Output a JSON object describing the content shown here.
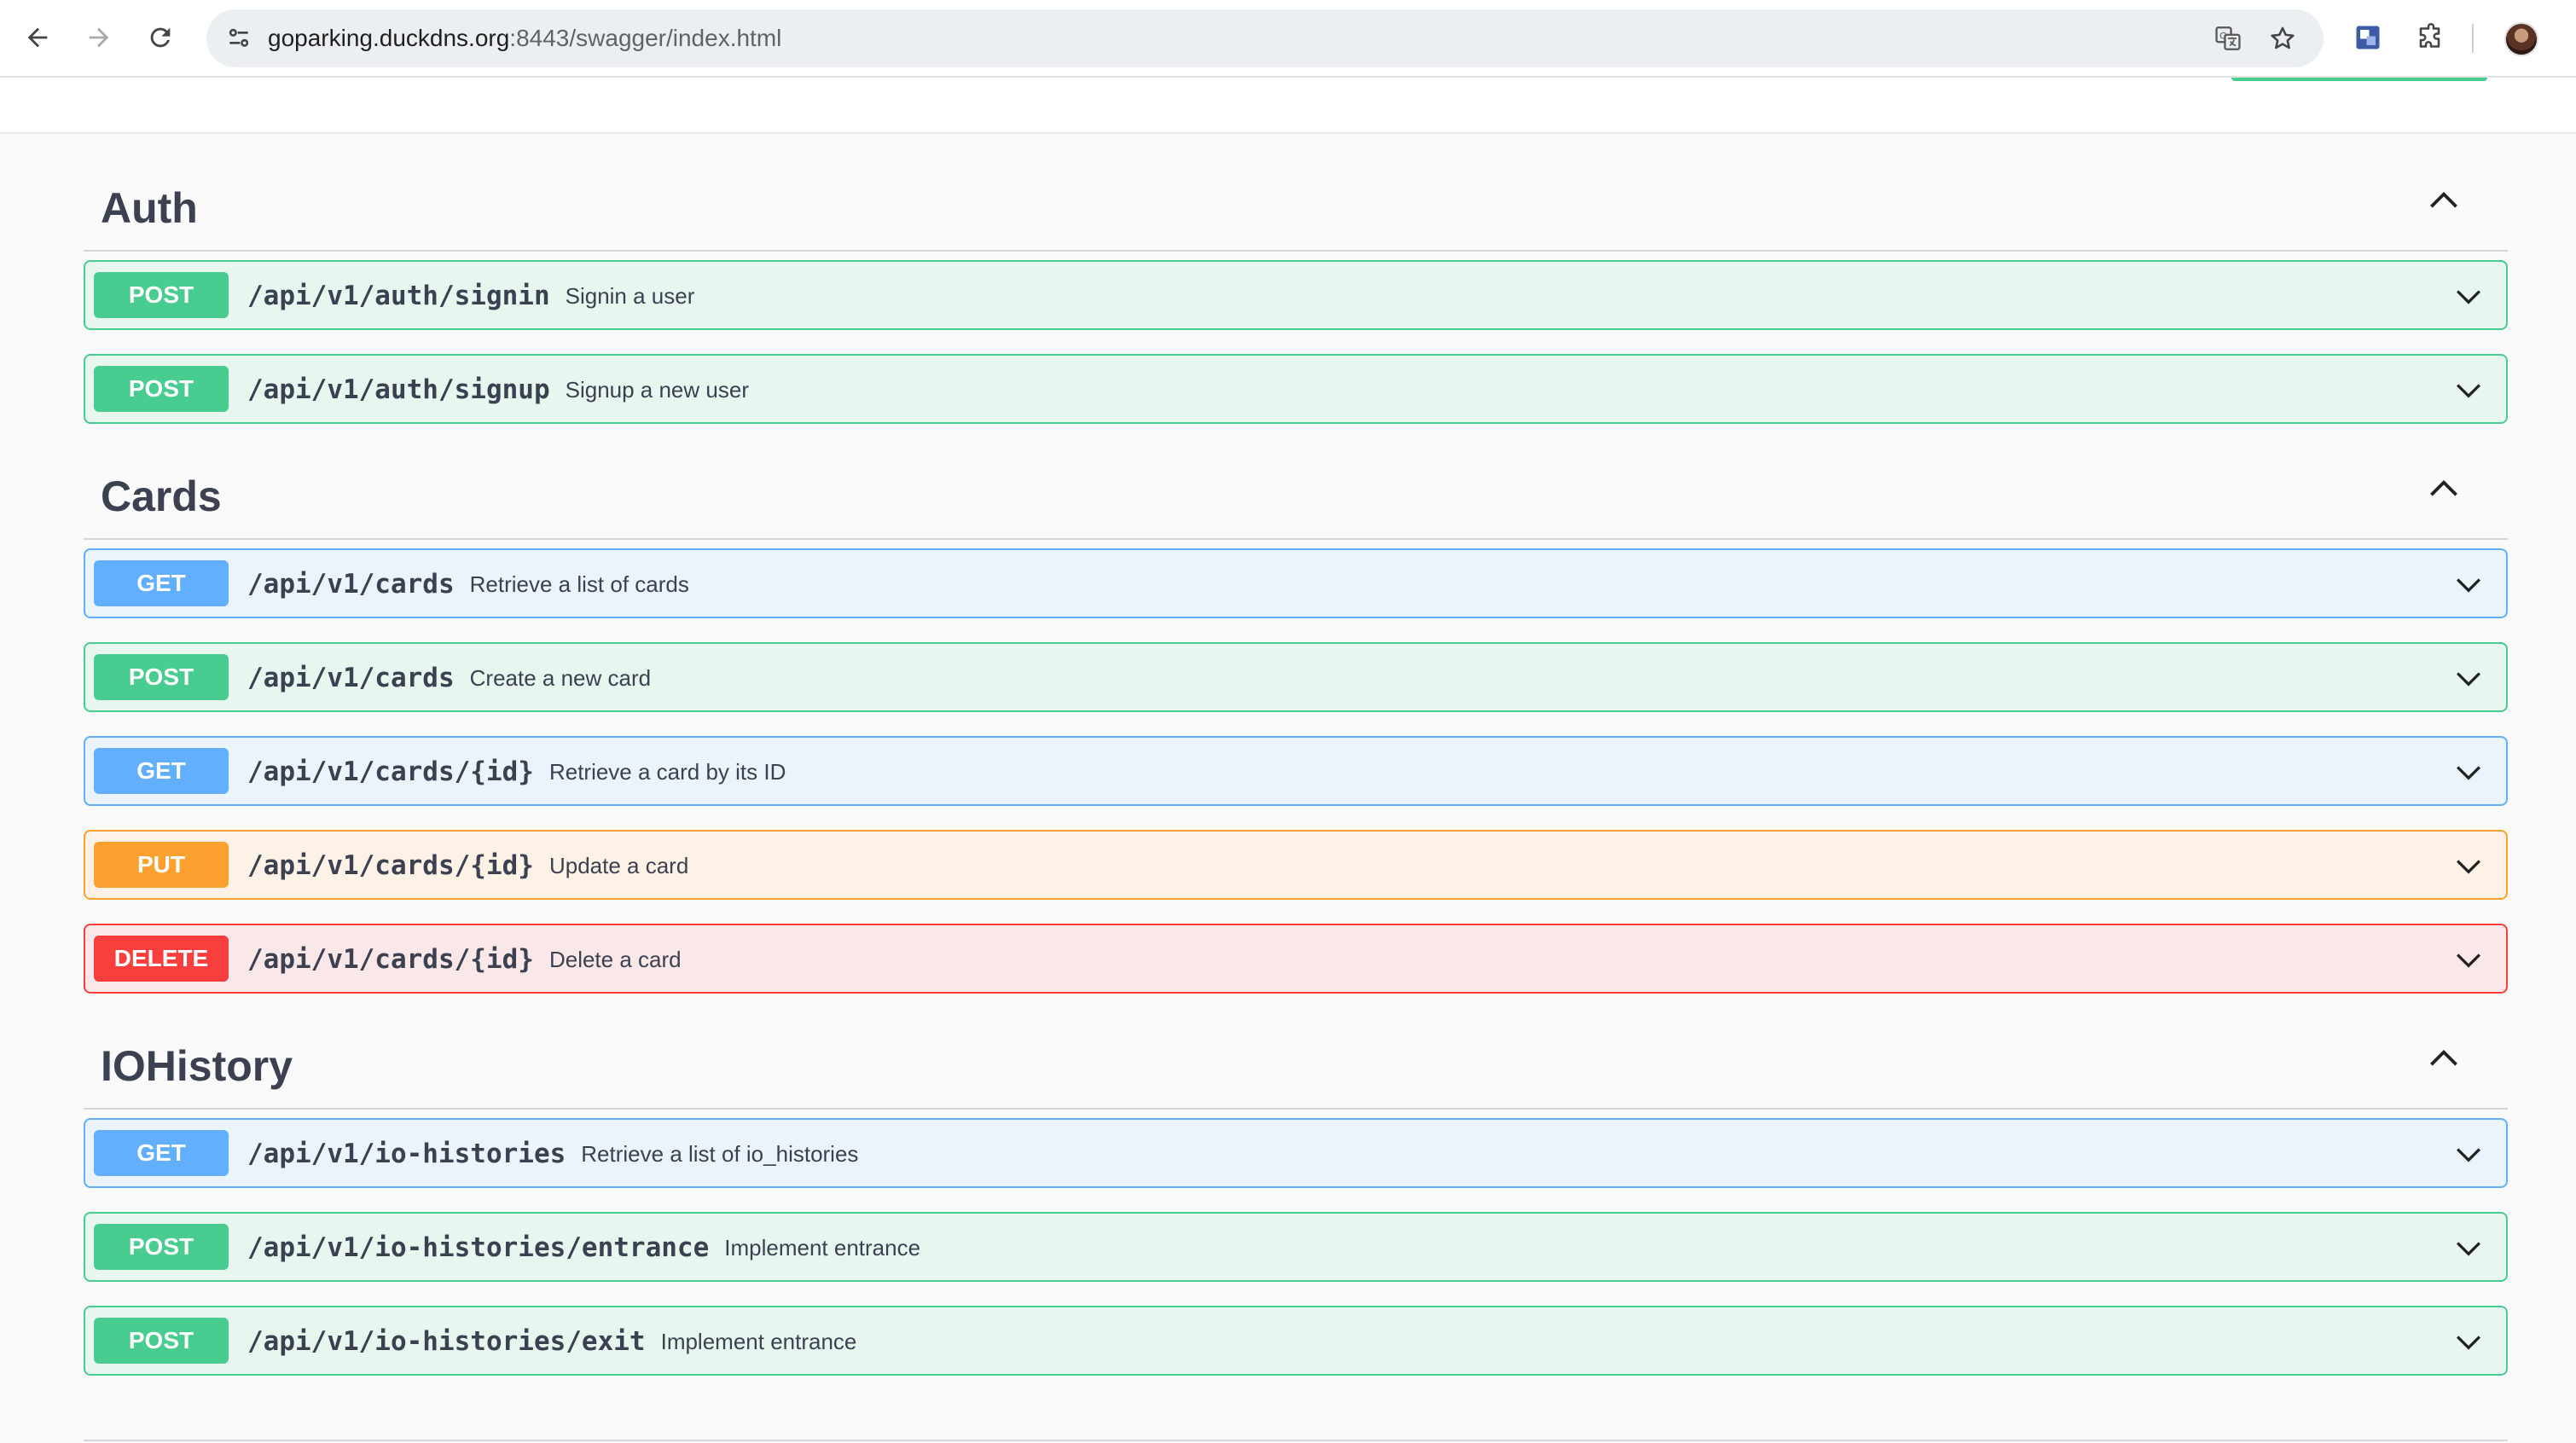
{
  "browser": {
    "url_host": "goparking.duckdns.org",
    "url_rest": ":8443/swagger/index.html",
    "icons": [
      "back-arrow-icon",
      "forward-arrow-icon",
      "reload-icon",
      "site-info-icon",
      "translate-icon",
      "star-icon",
      "extension-ext-icon",
      "puzzle-icon",
      "avatar"
    ]
  },
  "sections": [
    {
      "title": "Auth",
      "ops": [
        {
          "method": "POST",
          "path": "/api/v1/auth/signin",
          "summary": "Signin a user"
        },
        {
          "method": "POST",
          "path": "/api/v1/auth/signup",
          "summary": "Signup a new user"
        }
      ]
    },
    {
      "title": "Cards",
      "ops": [
        {
          "method": "GET",
          "path": "/api/v1/cards",
          "summary": "Retrieve a list of cards"
        },
        {
          "method": "POST",
          "path": "/api/v1/cards",
          "summary": "Create a new card"
        },
        {
          "method": "GET",
          "path": "/api/v1/cards/{id}",
          "summary": "Retrieve a card by its ID"
        },
        {
          "method": "PUT",
          "path": "/api/v1/cards/{id}",
          "summary": "Update a card"
        },
        {
          "method": "DELETE",
          "path": "/api/v1/cards/{id}",
          "summary": "Delete a card"
        }
      ]
    },
    {
      "title": "IOHistory",
      "ops": [
        {
          "method": "GET",
          "path": "/api/v1/io-histories",
          "summary": "Retrieve a list of io_histories"
        },
        {
          "method": "POST",
          "path": "/api/v1/io-histories/entrance",
          "summary": "Implement entrance"
        },
        {
          "method": "POST",
          "path": "/api/v1/io-histories/exit",
          "summary": "Implement entrance"
        }
      ]
    }
  ],
  "colors": {
    "post": "#49cc90",
    "get": "#61affe",
    "put": "#fca130",
    "delete": "#f93e3e"
  }
}
